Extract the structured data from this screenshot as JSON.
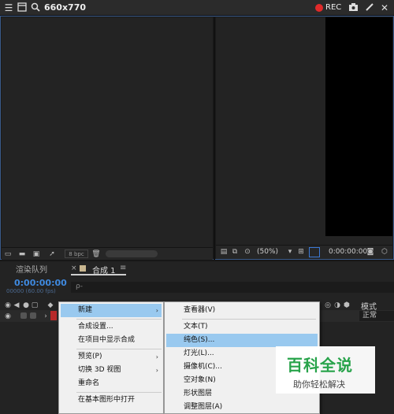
{
  "capture_bar": {
    "title": "660x770",
    "rec_label": "REC",
    "icons": [
      "hamburger-icon",
      "window-icon",
      "search-icon",
      "record-dot-icon",
      "camera-icon",
      "pen-icon",
      "close-icon"
    ]
  },
  "viewer_left": {
    "bpc_label": "8 bpc"
  },
  "viewer_right": {
    "zoom": "(50%)",
    "timecode": "0:00:00:00"
  },
  "timeline": {
    "tabs": {
      "render_queue": "渲染队列",
      "comp_close": "×",
      "comp_name": "合成 1",
      "comp_menu": "≡"
    },
    "current_time": "0:00:00:00",
    "current_frames": "00000 (60.00 fps)",
    "search_icon": "ρ-",
    "mode_header": "模式",
    "layer_mode": "正常"
  },
  "context_menu": {
    "items": [
      {
        "label": "新建",
        "submenu": true
      },
      {
        "label": "合成设置..."
      },
      {
        "label": "在项目中显示合成"
      },
      {
        "label": "预览(P)",
        "submenu": true
      },
      {
        "label": "切换 3D 视图",
        "submenu": true
      },
      {
        "label": "重命名"
      },
      {
        "label": "在基本图形中打开"
      }
    ],
    "submenu_arrow": "›"
  },
  "new_submenu": {
    "items": [
      {
        "label": "查看器(V)"
      },
      {
        "label": "文本(T)"
      },
      {
        "label": "纯色(S)..."
      },
      {
        "label": "灯光(L)..."
      },
      {
        "label": "摄像机(C)..."
      },
      {
        "label": "空对象(N)"
      },
      {
        "label": "形状图层"
      },
      {
        "label": "调整图层(A)"
      }
    ]
  },
  "watermark": {
    "title": "百科全说",
    "subtitle": "助你轻松解决"
  },
  "colors": {
    "accent_blue": "#3f8ae0",
    "menu_highlight": "#99c9ef",
    "rec_red": "#e02a2a",
    "watermark_green": "#27a34a"
  }
}
